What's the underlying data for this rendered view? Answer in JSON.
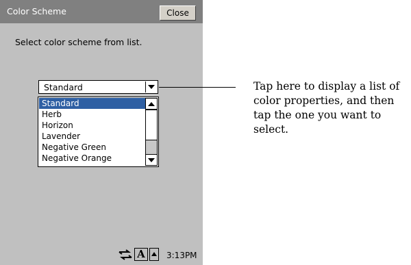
{
  "dialog": {
    "title": "Color Scheme",
    "close_label": "Close",
    "prompt": "Select color scheme from list."
  },
  "combo": {
    "value": "Standard"
  },
  "list": {
    "items": [
      "Standard",
      "Herb",
      "Horizon",
      "Lavender",
      "Negative Green",
      "Negative Orange"
    ],
    "selected": "Standard"
  },
  "taskbar": {
    "input_mode_label": "A",
    "time": "3:13PM",
    "icons": [
      "connectivity-icon",
      "input-mode-icon",
      "soft-keyboard-arrow-icon"
    ]
  },
  "callout": {
    "text": "Tap here to display a list of color properties, and then tap the one you want to select."
  },
  "colors": {
    "title_bar": "#808080",
    "dialog_bg": "#c0c0c0",
    "selection": "#2e5fa3"
  }
}
